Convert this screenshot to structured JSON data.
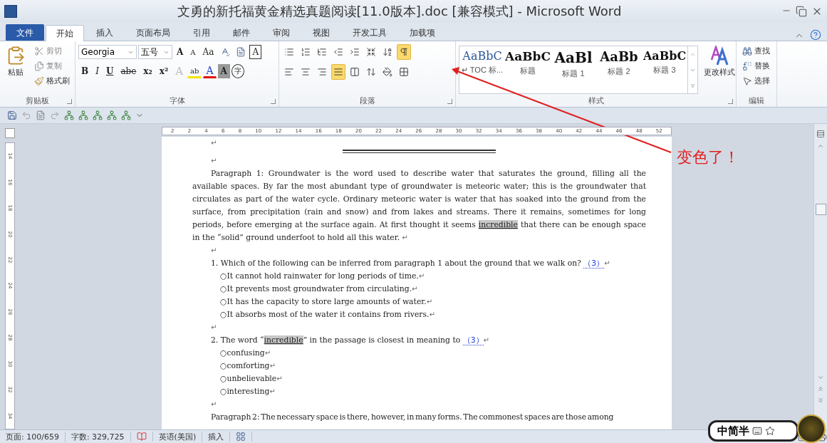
{
  "window": {
    "title": "文勇的新托福黄金精选真题阅读[11.0版本].doc [兼容模式] - Microsoft Word"
  },
  "tabs": [
    {
      "label": "文件",
      "kind": "file",
      "selected": false
    },
    {
      "label": "开始",
      "kind": "tab",
      "selected": true
    },
    {
      "label": "插入",
      "kind": "tab",
      "selected": false
    },
    {
      "label": "页面布局",
      "kind": "tab",
      "selected": false
    },
    {
      "label": "引用",
      "kind": "tab",
      "selected": false
    },
    {
      "label": "邮件",
      "kind": "tab",
      "selected": false
    },
    {
      "label": "审阅",
      "kind": "tab",
      "selected": false
    },
    {
      "label": "视图",
      "kind": "tab",
      "selected": false
    },
    {
      "label": "开发工具",
      "kind": "tab",
      "selected": false
    },
    {
      "label": "加载项",
      "kind": "tab",
      "selected": false
    }
  ],
  "clipboard": {
    "paste": "粘贴",
    "cut": "剪切",
    "copy": "复制",
    "painter": "格式刷",
    "label": "剪贴板"
  },
  "font": {
    "font": "Georgia",
    "size": "五号",
    "label": "字体",
    "row1": [
      {
        "kind": "grow",
        "glyph": "A"
      },
      {
        "kind": "shrink",
        "glyph": "A"
      },
      {
        "kind": "case",
        "glyph": "Aa"
      },
      {
        "kind": "phonetic"
      },
      {
        "kind": "wen"
      },
      {
        "kind": "border",
        "glyph": "A"
      }
    ],
    "row2": [
      {
        "kind": "bold",
        "glyph": "B"
      },
      {
        "kind": "italic",
        "glyph": "I"
      },
      {
        "kind": "underline",
        "glyph": "U"
      },
      {
        "kind": "strike",
        "glyph": "abe"
      },
      {
        "kind": "sub",
        "glyph": "x₂"
      },
      {
        "kind": "sup",
        "glyph": "x²"
      },
      {
        "kind": "effect",
        "glyph": "A"
      },
      {
        "kind": "highlight",
        "glyph": "ab"
      },
      {
        "kind": "color",
        "glyph": "A"
      },
      {
        "kind": "shade",
        "glyph": "A"
      },
      {
        "kind": "enclose",
        "glyph": "字"
      }
    ]
  },
  "paragraph": {
    "label": "段落",
    "row1": [
      {
        "kind": "bullets",
        "selected": false
      },
      {
        "kind": "numbering",
        "selected": false
      },
      {
        "kind": "multilevel",
        "selected": false
      },
      {
        "kind": "outdent",
        "selected": false
      },
      {
        "kind": "indent",
        "selected": false
      },
      {
        "kind": "asian",
        "selected": false
      },
      {
        "kind": "sort",
        "selected": false
      },
      {
        "kind": "marks",
        "selected": true
      }
    ],
    "row2": [
      {
        "kind": "left",
        "selected": false
      },
      {
        "kind": "center",
        "selected": false
      },
      {
        "kind": "right",
        "selected": false
      },
      {
        "kind": "justify",
        "selected": true
      },
      {
        "kind": "distribute",
        "selected": false
      },
      {
        "kind": "spacing",
        "selected": false
      },
      {
        "kind": "shading",
        "selected": false
      },
      {
        "kind": "borders",
        "selected": false
      }
    ]
  },
  "styles": {
    "label": "样式",
    "change": "更改样式",
    "items": [
      {
        "kind": "toc",
        "sample": "AaBbC",
        "name": "↵ TOC 标..."
      },
      {
        "kind": "title",
        "sample": "AaBbC",
        "name": "标题"
      },
      {
        "kind": "heading1",
        "sample": "AaBl",
        "name": "标题 1"
      },
      {
        "kind": "heading2",
        "sample": "AaBb",
        "name": "标题 2"
      },
      {
        "kind": "heading3",
        "sample": "AaBbC",
        "name": "标题 3"
      }
    ]
  },
  "editing": {
    "label": "编辑",
    "find": "查找",
    "replace": "替换",
    "select": "选择"
  },
  "ruler": [
    "2",
    "2",
    "4",
    "6",
    "8",
    "10",
    "12",
    "14",
    "16",
    "18",
    "20",
    "22",
    "24",
    "26",
    "28",
    "30",
    "32",
    "34",
    "36",
    "38",
    "40",
    "42",
    "44",
    "46",
    "48",
    "52"
  ],
  "vertical_ruler": [
    "14",
    "16",
    "18",
    "20",
    "22",
    "24",
    "26",
    "28",
    "30",
    "32",
    "34"
  ],
  "document": [
    {
      "kind": "blank",
      "mark": "↵"
    },
    {
      "kind": "rule"
    },
    {
      "kind": "blank",
      "mark": "↵"
    },
    {
      "kind": "paragraph",
      "mark": "↵",
      "runs": [
        {
          "text": "Paragraph 1: Groundwater is the word used to describe water that saturates the ground, filling all the available spaces. By far the most abundant type of groundwater is meteoric water; this is the groundwater that circulates as part of the water cycle. Ordinary meteoric water is water that has soaked into the ground from the surface, from precipitation (rain and snow) and from lakes and streams. There it remains, sometimes for long periods, before emerging at the surface again. At first thought it seems ",
          "highlighted": false
        },
        {
          "text": "incredible",
          "highlighted": true
        },
        {
          "text": " that there can be enough space in the “solid” ground underfoot to hold all this water.",
          "highlighted": false
        }
      ]
    },
    {
      "kind": "blank",
      "mark": "↵"
    },
    {
      "kind": "question",
      "number": "1.",
      "answer": "（3）",
      "mark": "↵",
      "runs": [
        {
          "text": "Which of the following can be inferred from paragraph 1 about the ground that we walk on?",
          "highlighted": false
        }
      ],
      "options": [
        {
          "marker": "○",
          "text": "It cannot hold rainwater for long periods of time.",
          "mark": "↵"
        },
        {
          "marker": "○",
          "text": "It prevents most groundwater from circulating.",
          "mark": "↵"
        },
        {
          "marker": "○",
          "text": "It has the capacity to store large amounts of water.",
          "mark": "↵"
        },
        {
          "marker": "○",
          "text": "It absorbs most of the water it contains from rivers.",
          "mark": "↵"
        }
      ]
    },
    {
      "kind": "blank",
      "mark": "↵"
    },
    {
      "kind": "question",
      "number": "2.",
      "answer": "（3）",
      "mark": "↵",
      "runs": [
        {
          "text": "The word “",
          "highlighted": false
        },
        {
          "text": "incredible",
          "highlighted": true
        },
        {
          "text": "” in the passage is closest in meaning to",
          "highlighted": false
        }
      ],
      "options": [
        {
          "marker": "○",
          "text": "confusing",
          "mark": "↵"
        },
        {
          "marker": "○",
          "text": "comforting",
          "mark": "↵"
        },
        {
          "marker": "○",
          "text": "unbelievable",
          "mark": "↵"
        },
        {
          "marker": "○",
          "text": "interesting",
          "mark": "↵"
        }
      ]
    },
    {
      "kind": "blank",
      "mark": "↵"
    },
    {
      "kind": "paragraph",
      "runs": [
        {
          "text": "Paragraph 2: The necessary space is there, however, in many forms. The commonest spaces are those among",
          "highlighted": false
        }
      ]
    }
  ],
  "annotation": {
    "text": "变色了！"
  },
  "status_bar": {
    "page": "页面: 100/659",
    "words": "字数: 329,725",
    "language": "英语(美国)",
    "mode": "插入"
  },
  "ime": {
    "text": "中简半"
  }
}
